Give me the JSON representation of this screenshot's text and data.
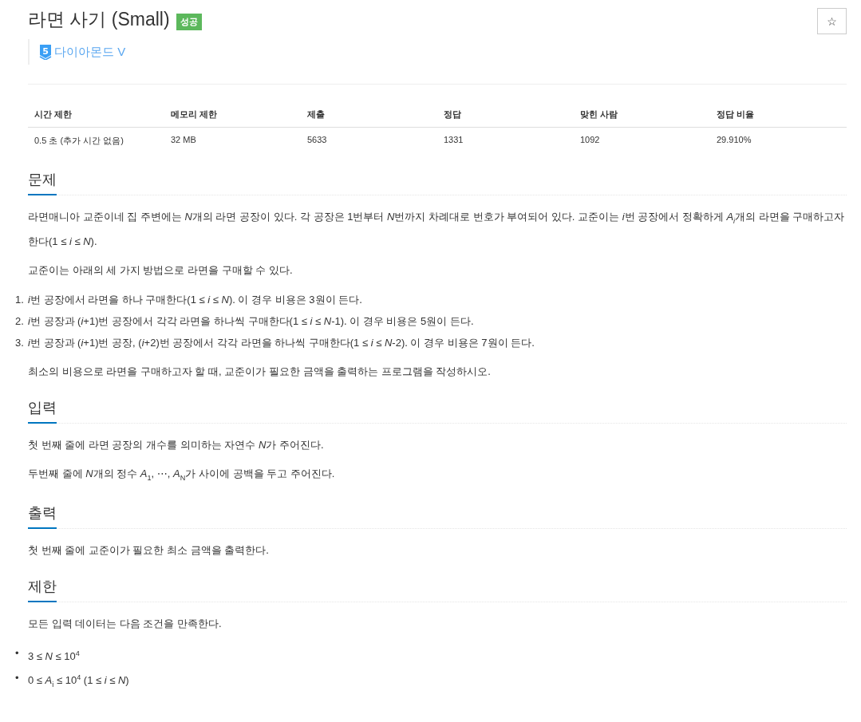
{
  "title": "라면 사기 (Small)",
  "result_badge": "성공",
  "star_button": "☆",
  "tier": {
    "number": "5",
    "label": "다이아몬드 V"
  },
  "info_table": {
    "columns": [
      "시간 제한",
      "메모리 제한",
      "제출",
      "정답",
      "맞힌 사람",
      "정답 비율"
    ],
    "rows": [
      [
        "0.5 초 (추가 시간 없음)",
        "32 MB",
        "5633",
        "1331",
        "1092",
        "29.910%"
      ]
    ]
  },
  "sections": [
    {
      "heading": "문제",
      "blocks": [
        {
          "kind": "paragraph",
          "runs": [
            {
              "text": "라면매니아 교준이네 집 주변에는 ",
              "italic": false
            },
            {
              "text": "N",
              "italic": true
            },
            {
              "text": "개의 라면 공장이 있다. 각 공장은 1번부터 ",
              "italic": false
            },
            {
              "text": "N",
              "italic": true
            },
            {
              "text": "번까지 차례대로 번호가 부여되어 있다. 교준이는 ",
              "italic": false
            },
            {
              "text": "i",
              "italic": true
            },
            {
              "text": "번 공장에서 정확하게 ",
              "italic": false
            },
            {
              "text": "A$_{i}$",
              "italic": true
            },
            {
              "text": "개의 라면을 구매하고자 한다(1 ≤ *i* ≤ *N*).",
              "italic": false
            }
          ]
        },
        {
          "kind": "paragraph",
          "runs": [
            {
              "text": "교준이는 아래의 세 가지 방법으로 라면을 구매할 수 있다.",
              "italic": false
            }
          ]
        },
        {
          "kind": "list",
          "items": [
            {
              "marker": "1.",
              "runs": [
                {
                  "text": "i",
                  "italic": true
                },
                {
                  "text": "번 공장에서 라면을 하나 구매한다(1 ≤ *i* ≤ *N*). 이 경우 비용은 3원이 든다.",
                  "italic": false
                }
              ]
            },
            {
              "marker": "2.",
              "runs": [
                {
                  "text": "i",
                  "italic": true
                },
                {
                  "text": "번 공장과 (*i*+1)번 공장에서 각각 라면을 하나씩 구매한다(1 ≤ *i* ≤ *N*-1). 이 경우 비용은 5원이 든다.",
                  "italic": false
                }
              ]
            },
            {
              "marker": "3.",
              "runs": [
                {
                  "text": "i",
                  "italic": true
                },
                {
                  "text": "번 공장과 (*i*+1)번 공장, (*i*+2)번 공장에서 각각 라면을 하나씩 구매한다(1 ≤ *i* ≤ *N*-2). 이 경우 비용은 7원이 든다.",
                  "italic": false
                }
              ]
            }
          ]
        },
        {
          "kind": "paragraph",
          "runs": [
            {
              "text": "최소의 비용으로 라면을 구매하고자 할 때, 교준이가 필요한 금액을 출력하는 프로그램을 작성하시오.",
              "italic": false
            }
          ]
        }
      ]
    },
    {
      "heading": "입력",
      "blocks": [
        {
          "kind": "paragraph",
          "runs": [
            {
              "text": "첫 번째 줄에 라면 공장의 개수를 의미하는 자연수 ",
              "italic": false
            },
            {
              "text": "N",
              "italic": true
            },
            {
              "text": "가 주어진다.",
              "italic": false
            }
          ]
        },
        {
          "kind": "paragraph",
          "runs": [
            {
              "text": "두번째 줄에 ",
              "italic": false
            },
            {
              "text": "N",
              "italic": true
            },
            {
              "text": "개의 정수 *A*$_{1}$, ⋯, *A*$_{N}$가 사이에 공백을 두고 주어진다.",
              "italic": false
            }
          ]
        }
      ]
    },
    {
      "heading": "출력",
      "blocks": [
        {
          "kind": "paragraph",
          "runs": [
            {
              "text": "첫 번째 줄에 교준이가 필요한 최소 금액을 출력한다.",
              "italic": false
            }
          ]
        }
      ]
    },
    {
      "heading": "제한",
      "blocks": [
        {
          "kind": "paragraph",
          "runs": [
            {
              "text": "모든 입력 데이터는 다음 조건을 만족한다.",
              "italic": false
            }
          ]
        },
        {
          "kind": "list",
          "items": [
            {
              "marker": "•",
              "runs": [
                {
                  "text": "3 ≤ *N* ≤ 10$^{4}$",
                  "italic": false
                }
              ]
            },
            {
              "marker": "•",
              "runs": [
                {
                  "text": "0 ≤ *A*$_{i}$ ≤ 10$^{4}$ (1 ≤ *i* ≤ *N*)",
                  "italic": false
                }
              ]
            }
          ]
        }
      ]
    }
  ]
}
